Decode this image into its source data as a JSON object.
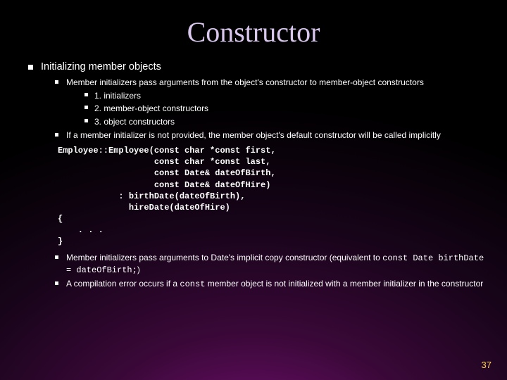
{
  "title": "Constructor",
  "main_bullet": "Initializing member objects",
  "sub1": "Member initializers pass arguments from the object's constructor to member-object constructors",
  "sub1a": "1. initializers",
  "sub1b": "2. member-object constructors",
  "sub1c": "3. object constructors",
  "sub2": "If a member initializer is not provided, the member object's default constructor will be called implicitly",
  "code": "Employee::Employee(const char *const first,\n                   const char *const last,\n                   const Date& dateOfBirth,\n                   const Date& dateOfHire)\n            : birthDate(dateOfBirth),\n              hireDate(dateOfHire)\n{\n    . . .\n}",
  "sub3_pre": "Member initializers pass arguments to Date's implicit copy constructor (equivalent to ",
  "sub3_code": "const Date birthDate = dateOfBirth;",
  "sub3_post": ")",
  "sub4_a": "A compilation error occurs if a ",
  "sub4_code": "const",
  "sub4_b": " member object is not initialized with a member initializer in the constructor",
  "page": "37"
}
